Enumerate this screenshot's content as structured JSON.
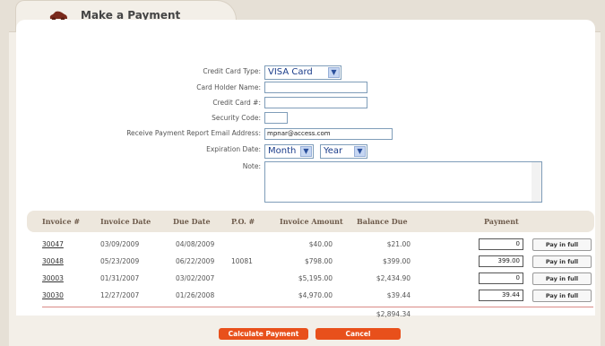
{
  "header": {
    "title": "Make a Payment",
    "icon": "car-icon"
  },
  "form": {
    "card_type_label": "Credit Card Type:",
    "card_type_value": "VISA Card",
    "holder_label": "Card Holder Name:",
    "holder_value": "",
    "card_number_label": "Credit Card #:",
    "card_number_value": "",
    "security_label": "Security Code:",
    "security_value": "",
    "email_label": "Receive Payment Report Email Address:",
    "email_value": "mpnar@access.com",
    "expiration_label": "Expiration Date:",
    "month_value": "Month",
    "year_value": "Year",
    "note_label": "Note:",
    "note_value": ""
  },
  "table": {
    "headers": [
      "Invoice #",
      "Invoice Date",
      "Due Date",
      "P.O. #",
      "Invoice Amount",
      "Balance Due",
      "Payment"
    ],
    "rows": [
      {
        "invoice": "30047",
        "inv_date": "03/09/2009",
        "due_date": "04/08/2009",
        "po": "",
        "amount": "$40.00",
        "balance": "$21.00",
        "payment": "0",
        "button": "Pay in full"
      },
      {
        "invoice": "30048",
        "inv_date": "05/23/2009",
        "due_date": "06/22/2009",
        "po": "10081",
        "amount": "$798.00",
        "balance": "$399.00",
        "payment": "399.00",
        "button": "Pay in full"
      },
      {
        "invoice": "30003",
        "inv_date": "01/31/2007",
        "due_date": "03/02/2007",
        "po": "",
        "amount": "$5,195.00",
        "balance": "$2,434.90",
        "payment": "0",
        "button": "Pay in full"
      },
      {
        "invoice": "30030",
        "inv_date": "12/27/2007",
        "due_date": "01/26/2008",
        "po": "",
        "amount": "$4,970.00",
        "balance": "$39.44",
        "payment": "39.44",
        "button": "Pay in full"
      }
    ],
    "total_balance": "$2,894.34"
  },
  "actions": {
    "calculate": "Calculate Payment",
    "cancel": "Cancel"
  },
  "colors": {
    "accent": "#e8501b",
    "header_text": "#6d5a4a",
    "background": "#e6e0d6"
  }
}
